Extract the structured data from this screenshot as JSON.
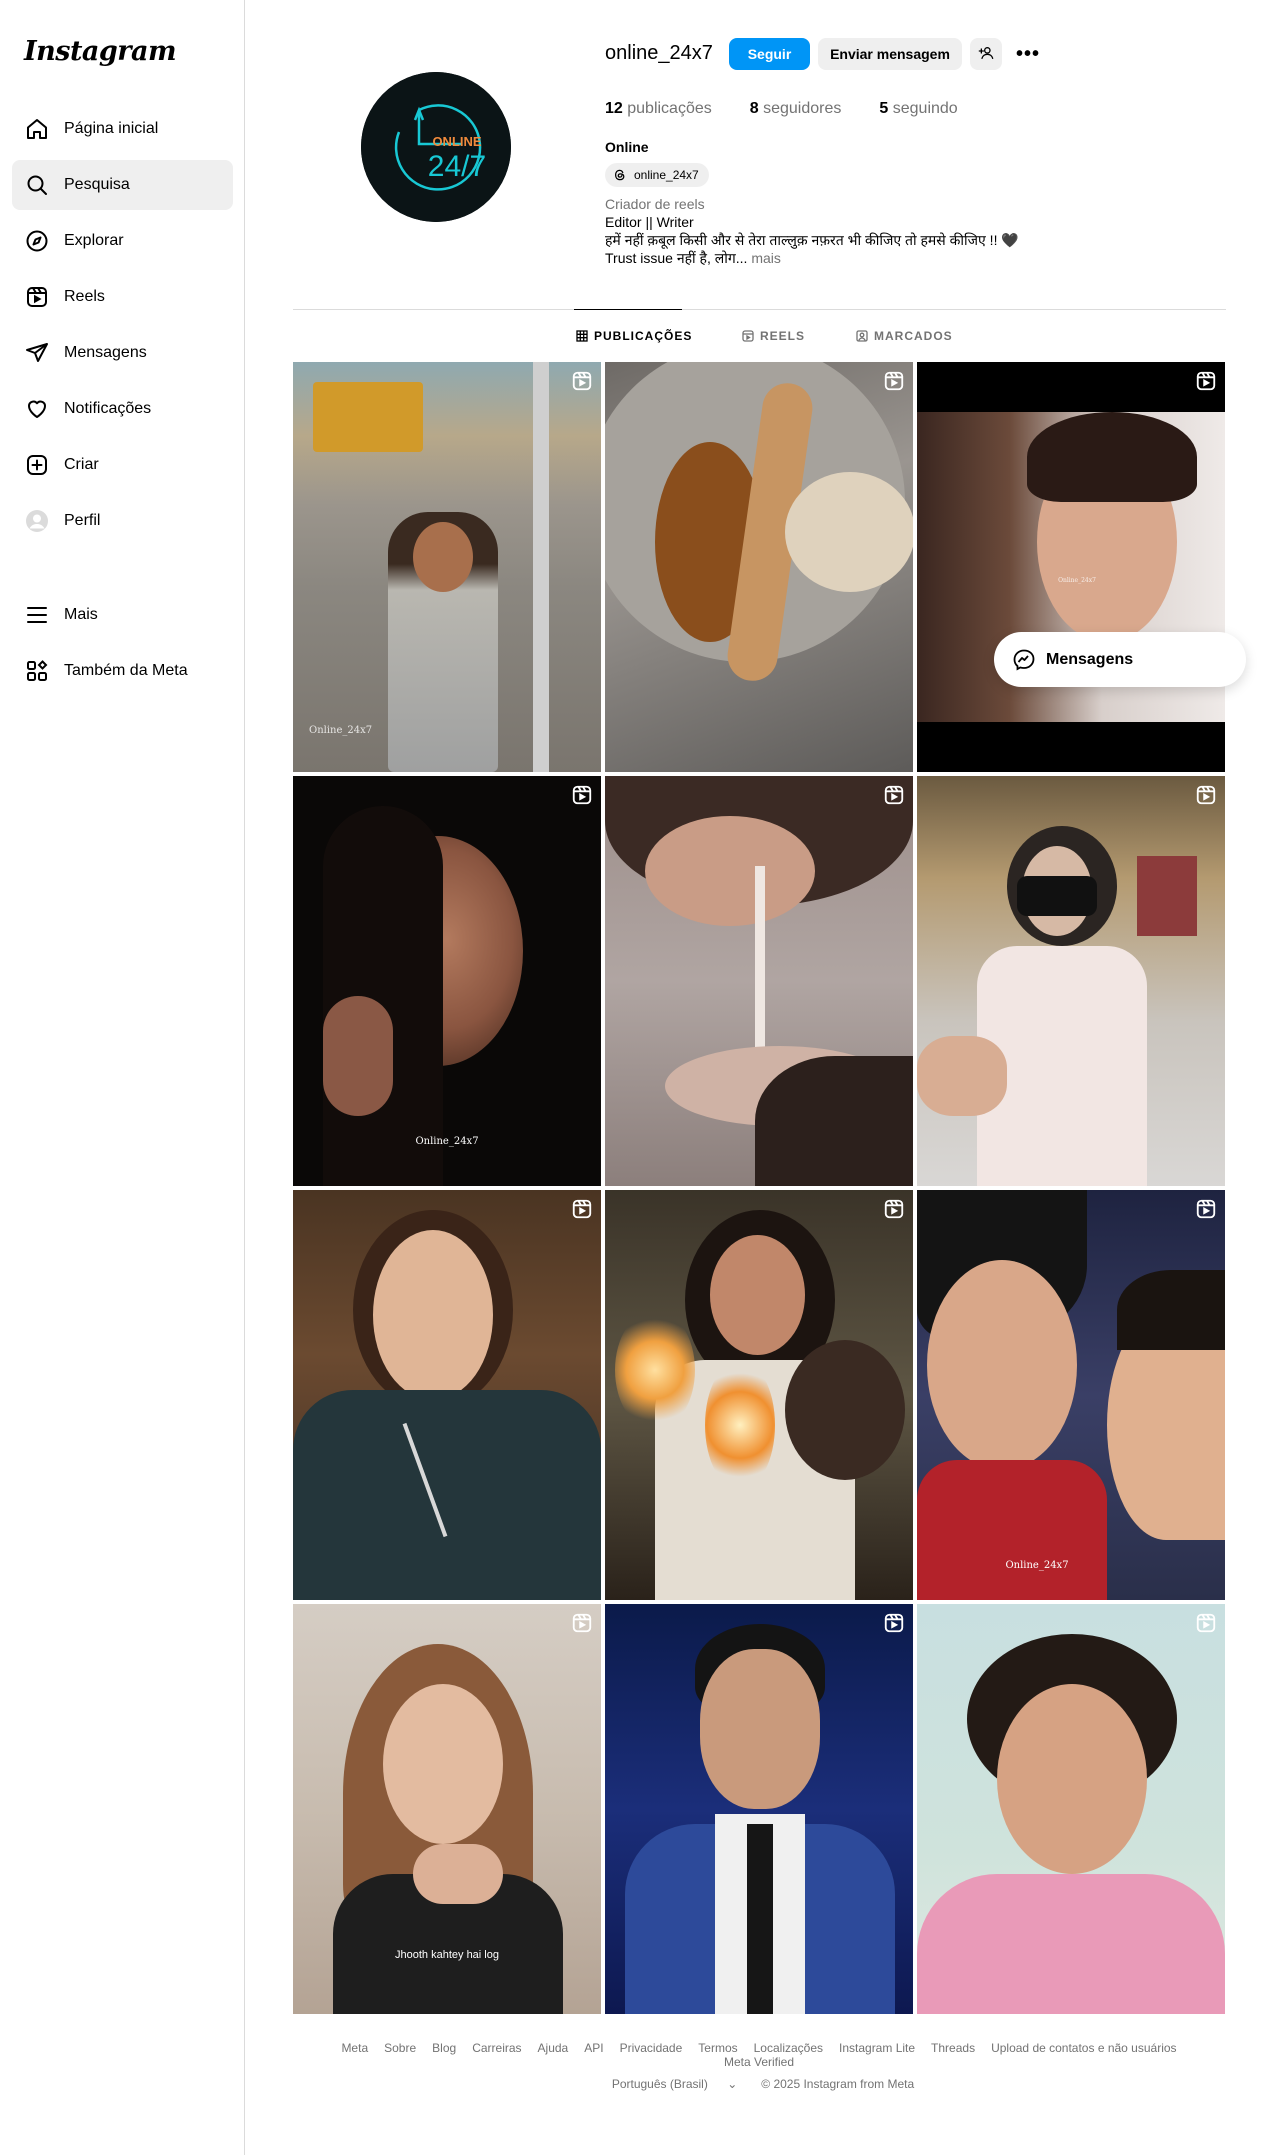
{
  "app": {
    "logo": "Instagram"
  },
  "sidebar": {
    "items": [
      {
        "label": "Página inicial",
        "icon": "home-icon"
      },
      {
        "label": "Pesquisa",
        "icon": "search-icon",
        "active": true
      },
      {
        "label": "Explorar",
        "icon": "compass-icon"
      },
      {
        "label": "Reels",
        "icon": "reels-icon"
      },
      {
        "label": "Mensagens",
        "icon": "send-icon"
      },
      {
        "label": "Notificações",
        "icon": "heart-icon"
      },
      {
        "label": "Criar",
        "icon": "plus-square-icon"
      },
      {
        "label": "Perfil",
        "icon": "profile-avatar-icon"
      }
    ],
    "bottom": [
      {
        "label": "Mais",
        "icon": "menu-icon"
      },
      {
        "label": "Também da Meta",
        "icon": "meta-apps-icon"
      }
    ]
  },
  "profile": {
    "username": "online_24x7",
    "follow_label": "Seguir",
    "message_label": "Enviar mensagem",
    "more_label": "•••",
    "avatar_text_top": "ONLINE",
    "avatar_text_bottom": "24/7",
    "stats": {
      "posts_count": "12",
      "posts_label": "publicações",
      "followers_count": "8",
      "followers_label": "seguidores",
      "following_count": "5",
      "following_label": "seguindo"
    },
    "full_name": "Online",
    "threads_handle": "online_24x7",
    "category": "Criador de reels",
    "bio_line1": "Editor || Writer",
    "bio_line2": "हमें नहीं क़बूल किसी और से तेरा ताल्लुक़ नफ़रत भी कीजिए तो हमसे कीजिए !! 🖤",
    "bio_line3": "Trust issue नहीं है, लोग...",
    "bio_more": "mais"
  },
  "tabs": [
    {
      "label": "PUBLICAÇÕES",
      "active": true
    },
    {
      "label": "REELS"
    },
    {
      "label": "MARCADOS"
    }
  ],
  "posts": [
    {
      "caption": "Online_24x7"
    },
    {
      "caption": ""
    },
    {
      "caption": "Online_24x7"
    },
    {
      "caption": "Online_24x7"
    },
    {
      "caption": ""
    },
    {
      "caption": ""
    },
    {
      "caption": ""
    },
    {
      "caption": ""
    },
    {
      "caption": "Online_24x7"
    },
    {
      "caption": "Jhooth kahtey hai log"
    },
    {
      "caption": ""
    },
    {
      "caption": ""
    }
  ],
  "floating_messages": {
    "label": "Mensagens"
  },
  "footer": {
    "links": [
      "Meta",
      "Sobre",
      "Blog",
      "Carreiras",
      "Ajuda",
      "API",
      "Privacidade",
      "Termos",
      "Localizações",
      "Instagram Lite",
      "Threads",
      "Upload de contatos e não usuários",
      "Meta Verified"
    ],
    "language": "Português (Brasil)",
    "copyright": "© 2025 Instagram from Meta"
  },
  "colors": {
    "accent": "#0095f6",
    "muted": "#737373",
    "border": "#dbdbdb"
  }
}
